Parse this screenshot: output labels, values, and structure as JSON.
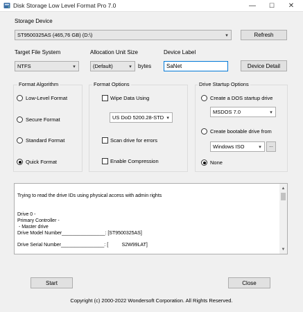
{
  "window": {
    "title": "Disk Storage Low Level Format Pro 7.0",
    "minimize_glyph": "—",
    "maximize_glyph": "☐",
    "close_glyph": "✕"
  },
  "storage": {
    "label": "Storage Device",
    "device": "ST9500325AS (465,76 GB) (D:\\)",
    "refresh": "Refresh"
  },
  "target_fs": {
    "label": "Target File System",
    "value": "NTFS"
  },
  "allocation": {
    "label": "Allocation Unit Size",
    "value": "(Default)",
    "unit": "bytes"
  },
  "device_label": {
    "label": "Device Label",
    "value": "SaNet"
  },
  "device_detail": "Device Detail",
  "format_algorithm": {
    "title": "Format Algorithm",
    "options": [
      "Low-Level Format",
      "Secure Format",
      "Standard Format",
      "Quick Format"
    ],
    "selected": "Quick Format"
  },
  "format_options": {
    "title": "Format Options",
    "wipe": "Wipe Data Using",
    "wipe_method": "US DoD 5200.28-STD",
    "scan": "Scan drive for errors",
    "compression": "Enable Compression"
  },
  "drive_startup": {
    "title": "Drive Startup Options",
    "dos": "Create a DOS startup drive",
    "dos_version": "MSDOS 7.0",
    "bootable": "Create bootable drive from",
    "bootable_source": "Windows ISO",
    "browse": "...",
    "none": "None",
    "selected": "None"
  },
  "log": {
    "lines": [
      "Trying to read the drive IDs using physical access with admin rights",
      "",
      "Drive 0 -",
      "Primary Controller -",
      " - Master drive",
      "Drive Model Number________________: [ST9500325AS]",
      "",
      "Drive Serial Number________________: [          S2W99LAT]"
    ]
  },
  "buttons": {
    "start": "Start",
    "close": "Close"
  },
  "copyright": "Copyright (c) 2000-2022 Wondersoft Corporation. All Rights Reserved.",
  "icons": {
    "app": "disk-icon",
    "caret": "▾",
    "scroll_up": "▲",
    "scroll_down": "▼"
  },
  "colors": {
    "focus_border": "#0078d7",
    "window_bg": "#f0f0f0"
  }
}
